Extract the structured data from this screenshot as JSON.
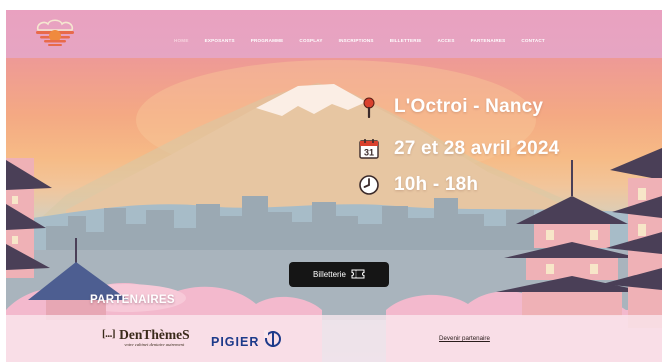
{
  "nav": {
    "items": [
      {
        "label": "HOME",
        "active": true
      },
      {
        "label": "EXPOSANTS",
        "active": false
      },
      {
        "label": "PROGRAMME",
        "active": false
      },
      {
        "label": "COSPLAY",
        "active": false
      },
      {
        "label": "INSCRIPTIONS",
        "active": false
      },
      {
        "label": "BILLETTERIE",
        "active": false
      },
      {
        "label": "ACCES",
        "active": false
      },
      {
        "label": "PARTENAIRES",
        "active": false
      },
      {
        "label": "CONTACT",
        "active": false
      }
    ]
  },
  "event": {
    "location": "L'Octroi - Nancy",
    "dates": "27 et 28 avril 2024",
    "calendar_day": "31",
    "hours": "10h - 18h",
    "icons": {
      "location": "pin-icon",
      "dates": "calendar-icon",
      "hours": "clock-icon"
    }
  },
  "ticket_button": {
    "label": "Billetterie",
    "icon": "ticket-icon"
  },
  "partners": {
    "title": "PARTENAIRES",
    "denthemes": {
      "brackets": "[...]",
      "name": "DenThèmeS",
      "tagline": "votre cabinet dentaire autrement"
    },
    "pigier": {
      "name": "PIGIER"
    },
    "become_link": "Devenir partenaire"
  },
  "colors": {
    "navbar": "#e9a1c0",
    "sky_top": "#ee9a96",
    "sky_mid": "#f6bb86",
    "button": "#151515",
    "pigier_blue": "#1d3a8a",
    "pagoda_roof": "#4a3f57",
    "pagoda_wall": "#efb1b6"
  }
}
